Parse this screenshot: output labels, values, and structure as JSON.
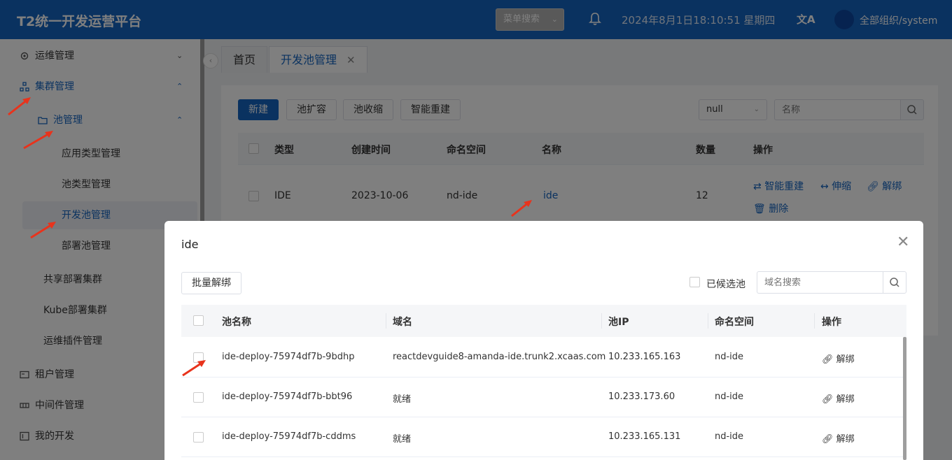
{
  "header": {
    "title": "T2统一开发运营平台",
    "menu_search": "菜单搜索",
    "datetime": "2024年8月1日18:10:51 星期四",
    "lang_icon": "文A",
    "org": "全部组织/system"
  },
  "sidebar": {
    "items": [
      {
        "label": "运维管理"
      },
      {
        "label": "集群管理"
      },
      {
        "label": "池管理"
      },
      {
        "label": "应用类型管理"
      },
      {
        "label": "池类型管理"
      },
      {
        "label": "开发池管理"
      },
      {
        "label": "部署池管理"
      },
      {
        "label": "共享部署集群"
      },
      {
        "label": "Kube部署集群"
      },
      {
        "label": "运维插件管理"
      },
      {
        "label": "租户管理"
      },
      {
        "label": "中间件管理"
      },
      {
        "label": "我的开发"
      }
    ]
  },
  "tabs": [
    {
      "label": "首页"
    },
    {
      "label": "开发池管理"
    }
  ],
  "toolbar": {
    "new": "新建",
    "expand": "池扩容",
    "shrink": "池收缩",
    "rebuild": "智能重建",
    "filter_value": "null",
    "name_placeholder": "名称"
  },
  "table": {
    "headers": [
      "类型",
      "创建时间",
      "命名空间",
      "名称",
      "数量",
      "操作"
    ],
    "rows": [
      {
        "type": "IDE",
        "created": "2023-10-06",
        "namespace": "nd-ide",
        "name": "ide",
        "count": "12",
        "actions": [
          "智能重建",
          "伸缩",
          "解绑",
          "删除"
        ]
      }
    ]
  },
  "modal": {
    "title": "ide",
    "batch_unbind": "批量解绑",
    "candidate_label": "已候选池",
    "domain_placeholder": "域名搜索",
    "headers": [
      "池名称",
      "域名",
      "池IP",
      "命名空间",
      "操作"
    ],
    "rows": [
      {
        "pool": "ide-deploy-75974df7b-9bdhp",
        "domain": "reactdevguide8-amanda-ide.trunk2.xcaas.com",
        "ip": "10.233.165.163",
        "namespace": "nd-ide",
        "action": "解绑"
      },
      {
        "pool": "ide-deploy-75974df7b-bbt96",
        "domain": "就绪",
        "ip": "10.233.173.60",
        "namespace": "nd-ide",
        "action": "解绑"
      },
      {
        "pool": "ide-deploy-75974df7b-cddms",
        "domain": "就绪",
        "ip": "10.233.165.131",
        "namespace": "nd-ide",
        "action": "解绑"
      }
    ]
  },
  "colors": {
    "primary": "#1565c0",
    "annotation": "#e8331c"
  }
}
